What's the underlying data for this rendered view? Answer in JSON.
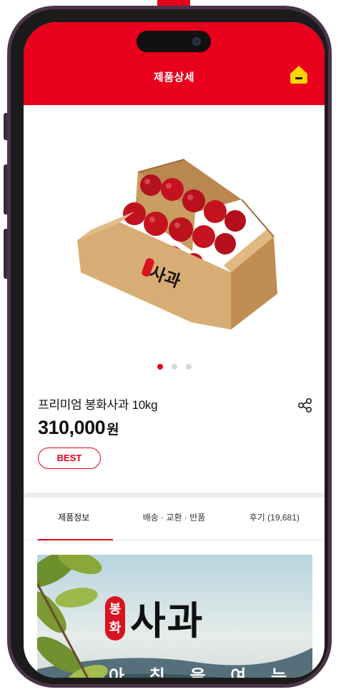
{
  "header": {
    "title": "제품상세",
    "home_icon": "home-icon"
  },
  "product": {
    "box_label": "사과",
    "box_seal": "봉화",
    "name": "프리미엄 봉화사과 10kg",
    "price": "310,000",
    "price_unit": "원",
    "badge": "BEST",
    "share_icon": "share-icon",
    "carousel": {
      "total": 3,
      "active_index": 0
    }
  },
  "tabs": [
    {
      "label": "제품정보",
      "active": true
    },
    {
      "label": "배송 · 교환 · 반품",
      "active": false
    },
    {
      "label": "후기 (19,681)",
      "active": false
    }
  ],
  "banner": {
    "seal_top": "봉",
    "seal_bottom": "화",
    "title": "사과",
    "subtitle": "아 침 을 여 는"
  },
  "colors": {
    "accent": "#e8001c",
    "home_icon": "#ffd400"
  }
}
